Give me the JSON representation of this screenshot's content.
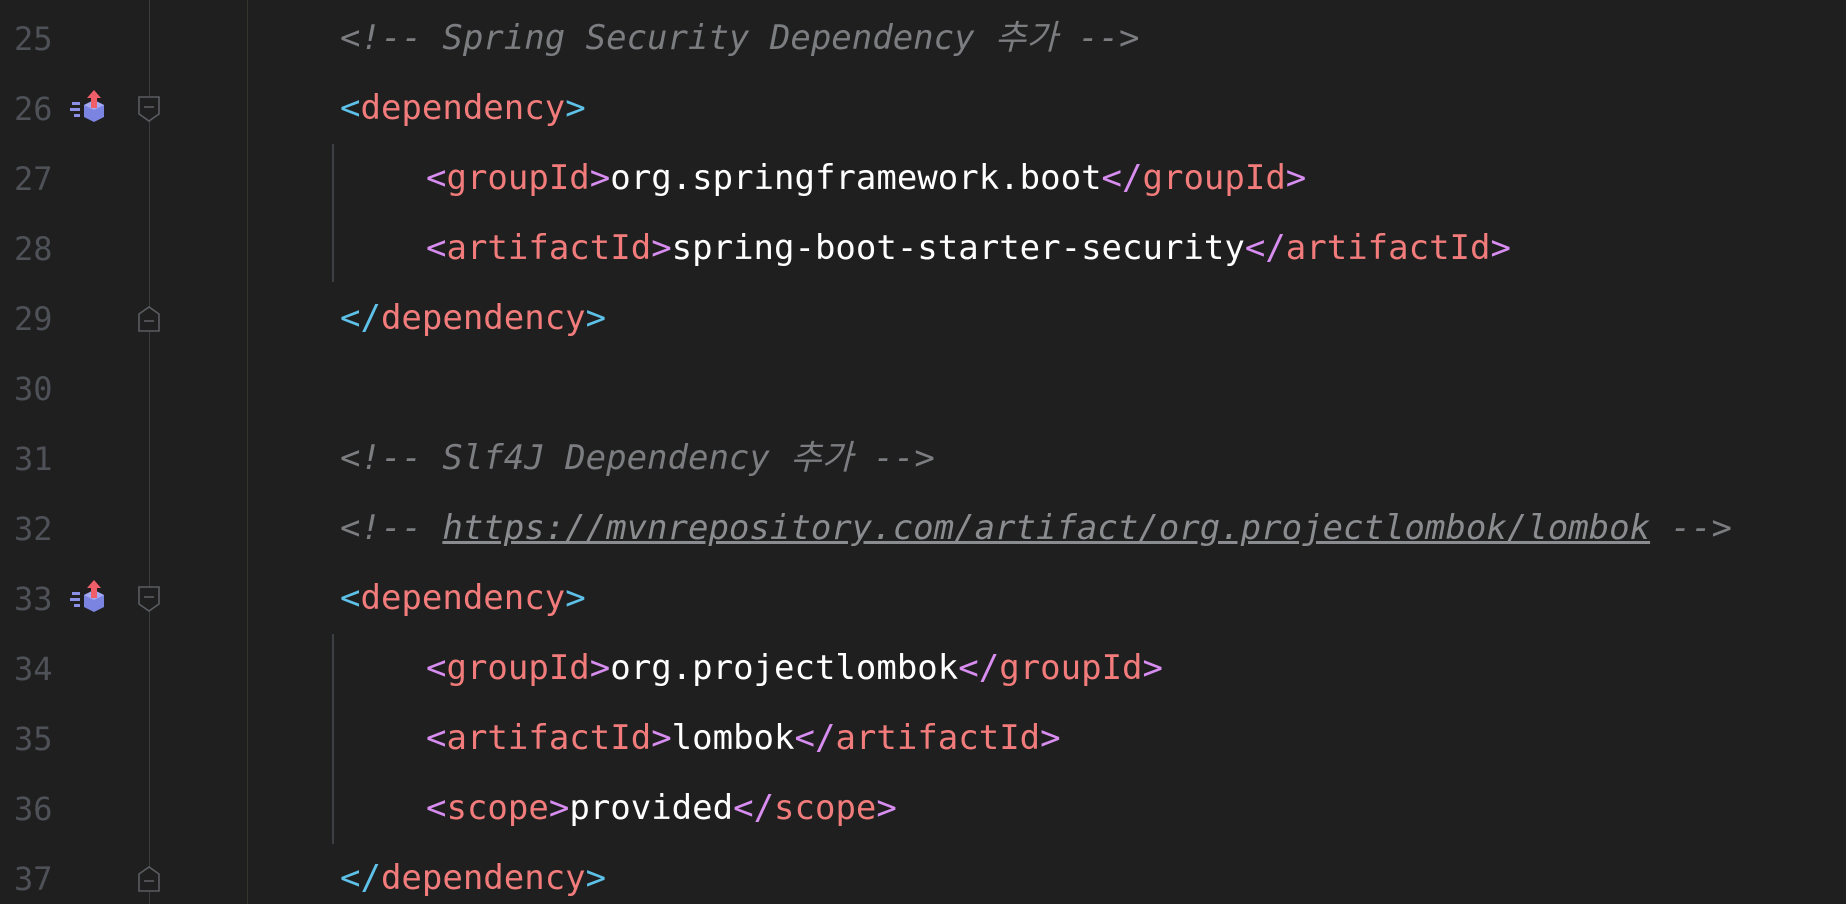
{
  "editor": {
    "lines": [
      {
        "number": "25",
        "comment_open": "<!-- ",
        "comment_text": "Spring Security Dependency 추가",
        "comment_close": " -->"
      },
      {
        "number": "26",
        "bracket_open": "<",
        "tag": "dependency",
        "bracket_close": ">"
      },
      {
        "number": "27",
        "tag1": "groupId",
        "value": "org.springframework.boot",
        "tag2": "groupId"
      },
      {
        "number": "28",
        "tag1": "artifactId",
        "value": "spring-boot-starter-security",
        "tag2": "artifactId"
      },
      {
        "number": "29",
        "bracket_open": "</",
        "tag": "dependency",
        "bracket_close": ">"
      },
      {
        "number": "30"
      },
      {
        "number": "31",
        "comment_open": "<!-- ",
        "comment_text": "Slf4J Dependency 추가",
        "comment_close": " -->"
      },
      {
        "number": "32",
        "comment_open": "<!-- ",
        "comment_url": "https://mvnrepository.com/artifact/org.projectlombok/lombok",
        "comment_close": " -->"
      },
      {
        "number": "33",
        "bracket_open": "<",
        "tag": "dependency",
        "bracket_close": ">"
      },
      {
        "number": "34",
        "tag1": "groupId",
        "value": "org.projectlombok",
        "tag2": "groupId"
      },
      {
        "number": "35",
        "tag1": "artifactId",
        "value": "lombok",
        "tag2": "artifactId"
      },
      {
        "number": "36",
        "tag1": "scope",
        "value": "provided",
        "tag2": "scope"
      },
      {
        "number": "37",
        "bracket_open": "</",
        "tag": "dependency",
        "bracket_close": ">"
      }
    ]
  },
  "colors": {
    "background": "#1f1f1f",
    "tag": "#f27b7b",
    "bracket": "#5ec1e8",
    "inner_bracket": "#d88df0",
    "comment": "#7b7d80",
    "line_number": "#4e5157"
  },
  "icons": {
    "gutter": "maven-dependency-icon",
    "fold_open": "fold-collapse-icon",
    "fold_end": "fold-end-icon"
  }
}
